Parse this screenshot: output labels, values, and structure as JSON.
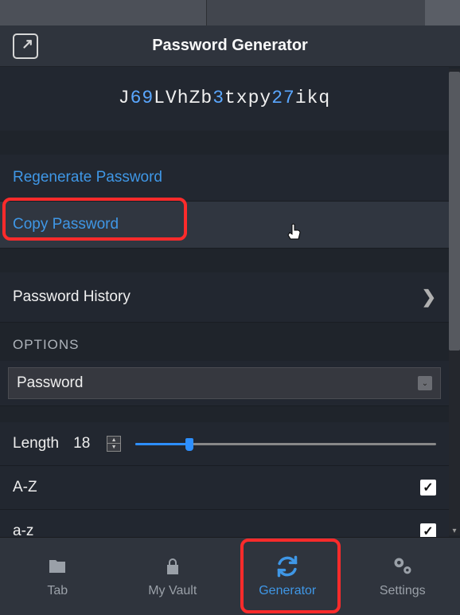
{
  "header": {
    "title": "Password Generator"
  },
  "password": {
    "segments": [
      {
        "t": "J",
        "c": "l"
      },
      {
        "t": "69",
        "c": "d"
      },
      {
        "t": "LVhZb",
        "c": "l"
      },
      {
        "t": "3",
        "c": "d"
      },
      {
        "t": "txpy",
        "c": "l"
      },
      {
        "t": "27",
        "c": "d"
      },
      {
        "t": "ikq",
        "c": "l"
      }
    ]
  },
  "actions": {
    "regenerate": "Regenerate Password",
    "copy": "Copy Password",
    "history": "Password History"
  },
  "options": {
    "section_label": "OPTIONS",
    "type_selected": "Password",
    "length_label": "Length",
    "length_value": "18",
    "chk_upper": "A-Z",
    "chk_lower": "a-z",
    "chk_upper_checked": true,
    "chk_lower_checked": true
  },
  "tabs": {
    "tab": "Tab",
    "vault": "My Vault",
    "generator": "Generator",
    "settings": "Settings",
    "active": "generator"
  },
  "colors": {
    "accent": "#3f97e6",
    "digit": "#5aa7ff",
    "bg": "#2f343d"
  }
}
